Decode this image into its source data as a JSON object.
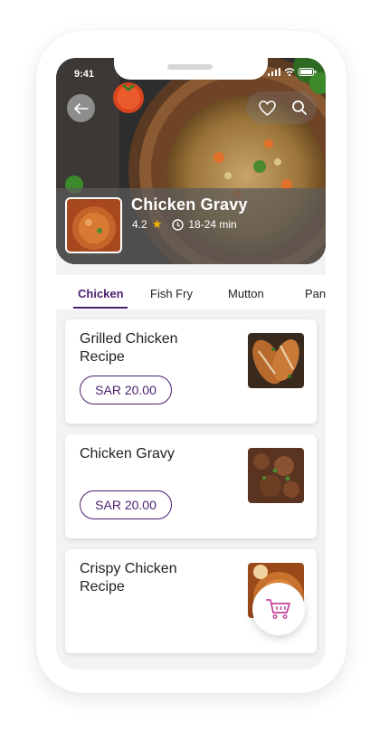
{
  "status_bar": {
    "time": "9:41"
  },
  "dish": {
    "title": "Chicken Gravy",
    "rating": "4.2",
    "duration": "18-24 min"
  },
  "tabs": [
    {
      "label": "Chicken",
      "active": true
    },
    {
      "label": "Fish Fry",
      "active": false
    },
    {
      "label": "Mutton",
      "active": false
    },
    {
      "label": "Pan",
      "active": false
    }
  ],
  "items": [
    {
      "title": "Grilled Chicken Recipe",
      "price": "SAR 20.00"
    },
    {
      "title": "Chicken Gravy",
      "price": "SAR 20.00"
    },
    {
      "title": "Crispy Chicken Recipe"
    }
  ],
  "icons": {
    "back": "arrow-left-icon",
    "favorite": "heart-icon",
    "search": "search-icon",
    "rating": "star-icon",
    "time": "clock-icon",
    "cart": "cart-icon"
  },
  "colors": {
    "accent": "#4a1f6e",
    "star": "#f5b400",
    "cart": "#c2409a"
  }
}
